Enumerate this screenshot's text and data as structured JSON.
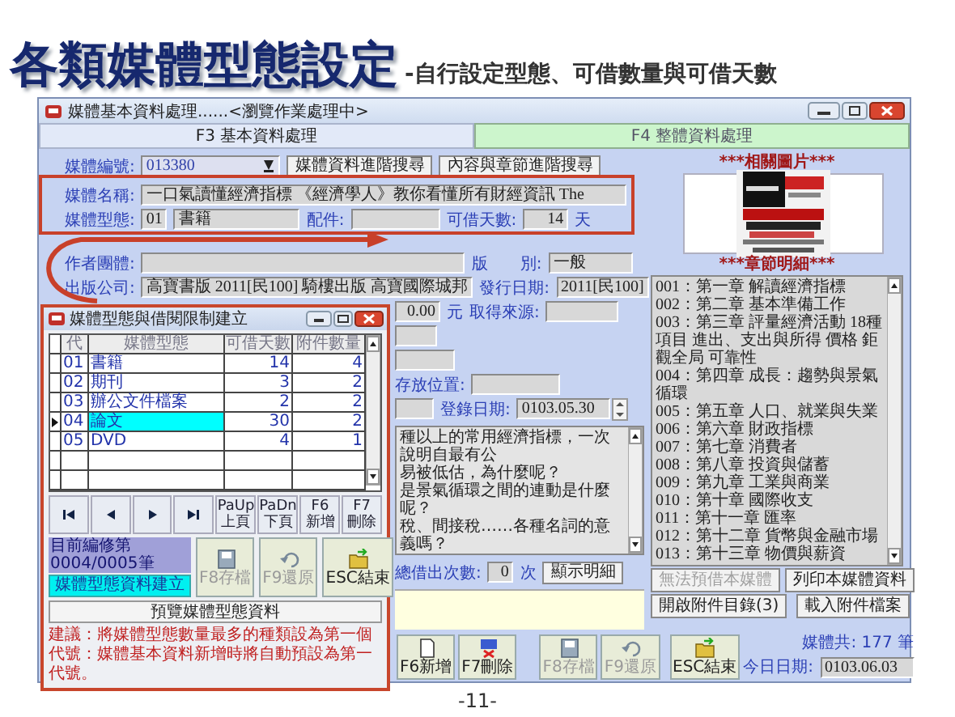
{
  "slide": {
    "title": "各類媒體型態設定",
    "subtitle": "-自行設定型態、可借數量與可借天數",
    "page_number": "-11-"
  },
  "window": {
    "title": "媒體基本資料處理......<瀏覽作業處理中>"
  },
  "tabs": [
    {
      "label": "F3 基本資料處理",
      "selected": true
    },
    {
      "label": "F4 整體資料處理",
      "selected": false
    }
  ],
  "form_rows": [
    {
      "items": [
        {
          "kind": "label",
          "text": "媒體編號:"
        },
        {
          "kind": "dropdown",
          "value": "013380"
        },
        {
          "kind": "button",
          "text": "媒體資料進階搜尋"
        },
        {
          "kind": "button",
          "text": "內容與章節進階搜尋"
        }
      ]
    },
    {
      "items": [
        {
          "kind": "label",
          "text": "媒體名稱:"
        },
        {
          "kind": "field",
          "value": "一口氣讀懂經濟指標 《經濟學人》教你看懂所有財經資訊 The"
        }
      ]
    },
    {
      "items": [
        {
          "kind": "label",
          "text": "媒體型態:"
        },
        {
          "kind": "field",
          "value": "01"
        },
        {
          "kind": "field",
          "value": "書籍"
        },
        {
          "kind": "label",
          "text": "配件:"
        },
        {
          "kind": "field"
        },
        {
          "kind": "label",
          "text": "可借天數:"
        },
        {
          "kind": "field",
          "value": "14"
        },
        {
          "kind": "unit",
          "text": "天"
        }
      ]
    },
    {
      "items": [
        {
          "kind": "label",
          "text": "作者團體:"
        },
        {
          "kind": "field"
        },
        {
          "kind": "label",
          "text": "版　　別:"
        },
        {
          "kind": "field",
          "value": "一般"
        }
      ]
    },
    {
      "items": [
        {
          "kind": "label",
          "text": "出版公司:"
        },
        {
          "kind": "field",
          "value": "高寶書版 2011[民100] 騎樓出版 高寶國際城邦"
        },
        {
          "kind": "label",
          "text": "發行日期:"
        },
        {
          "kind": "field",
          "value": "2011[民100]"
        }
      ]
    },
    {
      "items": [
        {
          "kind": "field",
          "value": "0.00"
        },
        {
          "kind": "unit",
          "text": "元"
        },
        {
          "kind": "label",
          "text": "取得來源:"
        },
        {
          "kind": "field"
        }
      ]
    },
    {
      "items": [
        {
          "kind": "field"
        }
      ]
    },
    {
      "items": [
        {
          "kind": "field"
        }
      ]
    },
    {
      "items": [
        {
          "kind": "label",
          "text": "存放位置:"
        },
        {
          "kind": "field"
        }
      ]
    },
    {
      "items": [
        {
          "kind": "field"
        },
        {
          "kind": "label",
          "text": "登錄日期:"
        },
        {
          "kind": "spinner",
          "value": "0103.05.30"
        }
      ]
    }
  ],
  "description_lines": [
    "種以上的常用經濟指標，一次說明自最有公",
    "易被低估，為什麼呢？",
    "是景氣循環之間的連動是什麼呢？",
    "稅、間接稅……各種名詞的意義嗎？"
  ],
  "loan_count": {
    "label": "總借出次數:",
    "value": "0",
    "unit": "次",
    "button": "顯示明細"
  },
  "toolbar": [
    {
      "label": "F6新增",
      "disabled": false
    },
    {
      "label": "F7刪除",
      "disabled": false
    },
    {
      "label": "F8存檔",
      "disabled": true
    },
    {
      "label": "F9還原",
      "disabled": true
    },
    {
      "label": "ESC結束",
      "disabled": false
    }
  ],
  "image_panel": {
    "heading": "***相關圖片***"
  },
  "chapters": {
    "heading": "***章節明細***",
    "items": [
      "001：第一章 解讀經濟指標",
      "002：第二章 基本準備工作",
      "003：第三章 評量經濟活動 18種項目 進出、支出與所得 價格 鉅觀全局 可靠性",
      "004：第四章 成長：趨勢與景氣循環",
      "005：第五章 人口、就業與失業",
      "006：第六章 財政指標",
      "007：第七章 消費者",
      "008：第八章 投資與儲蓄",
      "009：第九章 工業與商業",
      "010：第十章 國際收支",
      "011：第十一章 匯率",
      "012：第十二章 貨幣與金融市場",
      "013：第十三章 物價與薪資"
    ]
  },
  "side_buttons": [
    {
      "label": "無法預借本媒體",
      "disabled": true
    },
    {
      "label": "列印本媒體資料",
      "disabled": false
    },
    {
      "label": "開啟附件目錄(3)",
      "disabled": false
    },
    {
      "label": "載入附件檔案",
      "disabled": false
    }
  ],
  "status": {
    "count": "媒體共: 177 筆",
    "date_label": "今日日期:",
    "date_value": "0103.06.03"
  },
  "dialog": {
    "title": "媒體型態與借閱限制建立",
    "columns": [
      "代",
      "媒體型態",
      "可借天數",
      "附件數量"
    ],
    "rows": [
      {
        "code": "01",
        "type": "書籍",
        "days": "14",
        "attachments": "4",
        "selected": false
      },
      {
        "code": "02",
        "type": "期刊",
        "days": "3",
        "attachments": "2",
        "selected": false
      },
      {
        "code": "03",
        "type": "辦公文件檔案",
        "days": "2",
        "attachments": "2",
        "selected": false
      },
      {
        "code": "04",
        "type": "論文",
        "days": "30",
        "attachments": "2",
        "selected": true
      },
      {
        "code": "05",
        "type": "DVD",
        "days": "4",
        "attachments": "1",
        "selected": false
      }
    ],
    "page_buttons": [
      {
        "line1": "PaUp",
        "line2": "上頁"
      },
      {
        "line1": "PaDn",
        "line2": "下頁"
      },
      {
        "line1": "F6",
        "line2": "新增"
      },
      {
        "line1": "F7",
        "line2": "刪除"
      }
    ],
    "record_status": "目前編修第0004/0005筆",
    "mode_button": "媒體型態資料建立",
    "actions": [
      {
        "label": "F8存檔",
        "disabled": true
      },
      {
        "label": "F9還原",
        "disabled": true
      },
      {
        "label": "ESC結束",
        "disabled": false
      }
    ],
    "preview_button": "預覽媒體型態資料",
    "note": "建議：將媒體型態數量最多的種類設為第一個代號：媒體基本資料新增時將自動預設為第一代號。"
  }
}
